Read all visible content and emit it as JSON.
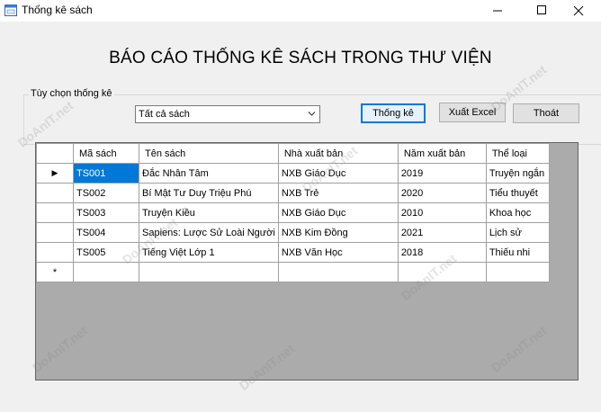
{
  "window": {
    "title": "Thống kê sách",
    "minimize_glyph": "—",
    "maximize_glyph": "☐",
    "close_glyph": "✕"
  },
  "report": {
    "title": "BÁO CÁO THỐNG KÊ SÁCH TRONG THƯ VIỆN"
  },
  "options": {
    "group_label": "Tùy chọn thống kê",
    "filter_value": "Tất cả sách",
    "buttons": {
      "stat": "Thống kê",
      "export": "Xuất Excel",
      "exit": "Thoát"
    }
  },
  "grid": {
    "columns": [
      "Mã sách",
      "Tên sách",
      "Nhà xuất bản",
      "Năm xuất bản",
      "Thể loại"
    ],
    "rows": [
      [
        "TS001",
        "Đắc Nhân Tâm",
        "NXB Giáo Dục",
        "2019",
        "Truyện ngắn"
      ],
      [
        "TS002",
        "Bí Mật Tư Duy Triệu Phú",
        "NXB Trẻ",
        "2020",
        "Tiểu thuyết"
      ],
      [
        "TS003",
        "Truyện Kiều",
        "NXB Giáo Dục",
        "2010",
        "Khoa học"
      ],
      [
        "TS004",
        "Sapiens: Lược Sử Loài Người",
        "NXB Kim Đồng",
        "2021",
        "Lịch sử"
      ],
      [
        "TS005",
        "Tiếng Việt Lớp 1",
        "NXB Văn Học",
        "2018",
        "Thiếu nhi"
      ]
    ],
    "current_row_glyph": "▶",
    "new_row_glyph": "*"
  },
  "watermark": {
    "text": "DoAnIT.net"
  },
  "colors": {
    "selection": "#0078d7",
    "grid_background": "#ababab",
    "window_background": "#f0f0f0"
  }
}
